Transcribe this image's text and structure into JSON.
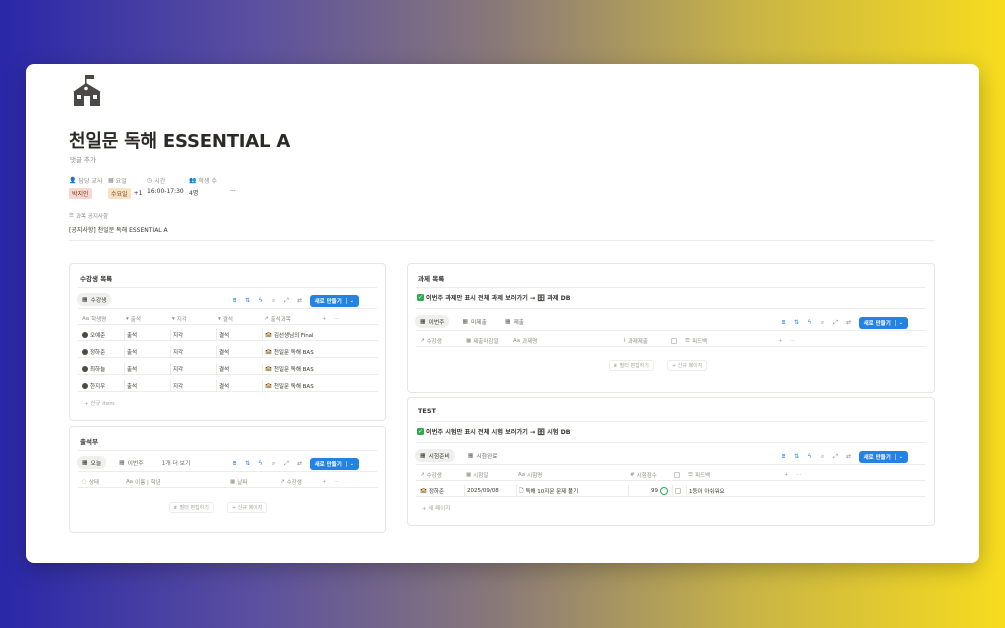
{
  "page": {
    "title": "천일문 독해 ESSENTIAL A",
    "add_comment": "댓글 추가",
    "icon": "school-icon"
  },
  "properties": {
    "teacher": {
      "label": "담당 교사",
      "value": "박지인",
      "color": "#f5d8cf"
    },
    "day": {
      "label": "요일",
      "value": "수요일",
      "extra": "+1",
      "color": "#f7e2c2"
    },
    "time": {
      "label": "시간",
      "value": "16:00-17:30"
    },
    "students": {
      "label": "학생 수",
      "value": "4명"
    },
    "more": "···"
  },
  "notice": {
    "label": "과목 공지사항",
    "value": "[공지사항] 천일문 독해 ESSENTIAL A"
  },
  "students_panel": {
    "title": "수강생 목록",
    "tab": "수강생",
    "new_button": "새로 만들기",
    "columns": [
      "학생명",
      "출석",
      "지각",
      "결석",
      "출석과목"
    ],
    "rows": [
      {
        "name": "오예준",
        "attend": "출석",
        "late": "지각",
        "absent": "결석",
        "course": "김선생님의 Final"
      },
      {
        "name": "정하준",
        "attend": "출석",
        "late": "지각",
        "absent": "결석",
        "course": "천일문 독해 BAS"
      },
      {
        "name": "최하늘",
        "attend": "출석",
        "late": "지각",
        "absent": "결석",
        "course": "천일문 독해 BAS"
      },
      {
        "name": "한지우",
        "attend": "출석",
        "late": "지각",
        "absent": "결석",
        "course": "천일문 독해 BAS"
      }
    ],
    "add_item": "+ 신규 item"
  },
  "attendance_panel": {
    "title": "출석부",
    "tabs": [
      "오늘",
      "이번주",
      "1개 더 보기"
    ],
    "new_button": "새로 만들기",
    "columns": [
      "상태",
      "이름 | 학년",
      "날짜",
      "수강생"
    ],
    "filter_edit": "필터 편집하기",
    "new_page": "+ 신규 페이지"
  },
  "assignment_panel": {
    "title": "과제 목록",
    "subtitle_prefix": "이번주 과제만 표시 전체 과제 보러가기 →",
    "subtitle_link": "과제 DB",
    "tabs": [
      "이번주",
      "미제출",
      "제출"
    ],
    "new_button": "새로 만들기",
    "columns": [
      "수강생",
      "제출마감일",
      "과제명",
      "과제제출",
      "피드백"
    ],
    "filter_edit": "필터 편집하기",
    "new_page": "+ 신규 페이지"
  },
  "test_panel": {
    "title": "TEST",
    "subtitle_prefix": "이번주 시험만 표시 전체 시험 보러가기 →",
    "subtitle_link": "시험 DB",
    "tabs": [
      "시험준비",
      "시험완료"
    ],
    "new_button": "새로 만들기",
    "columns": [
      "수강생",
      "시험일",
      "시험명",
      "시험점수",
      "피드백"
    ],
    "rows": [
      {
        "student": "정하준",
        "date": "2025/09/08",
        "name": "독해 10지문 문제 풀기",
        "score": "99",
        "feedback": "1등이 아쉬워요"
      }
    ],
    "new_page": "+ 새 페이지"
  },
  "colors": {
    "accent": "#2383e2",
    "success": "#2fa84f"
  }
}
